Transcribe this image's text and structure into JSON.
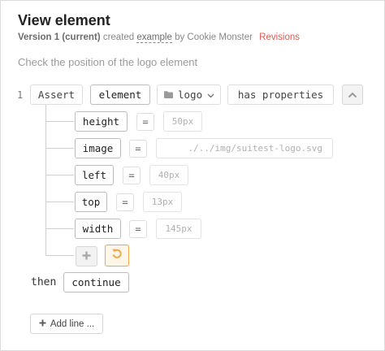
{
  "header": {
    "title": "View element",
    "version": "Version 1 (current)",
    "created": "created",
    "example": "example",
    "by": "by Cookie Monster",
    "revisions": "Revisions"
  },
  "description": "Check the position of the logo element",
  "line": {
    "number": "1",
    "assert": "Assert",
    "subject": "element",
    "element_name": "logo",
    "has_properties": "has properties",
    "properties": [
      {
        "name": "height",
        "op": "=",
        "value": "50px"
      },
      {
        "name": "image",
        "op": "=",
        "value": "./../img/suitest-logo.svg"
      },
      {
        "name": "left",
        "op": "=",
        "value": "40px"
      },
      {
        "name": "top",
        "op": "=",
        "value": "13px"
      },
      {
        "name": "width",
        "op": "=",
        "value": "145px"
      }
    ],
    "then": "then",
    "continue": "continue"
  },
  "add_line_label": "Add line ...",
  "icons": {
    "element_type": "folder-icon",
    "dropdown": "chevron-down-icon",
    "collapse": "chevron-up-icon",
    "add": "plus-icon",
    "reset": "undo-icon",
    "add_line": "plus-icon"
  },
  "colors": {
    "revisions": "#e05a4f",
    "reset_accent": "#f0a64a"
  }
}
